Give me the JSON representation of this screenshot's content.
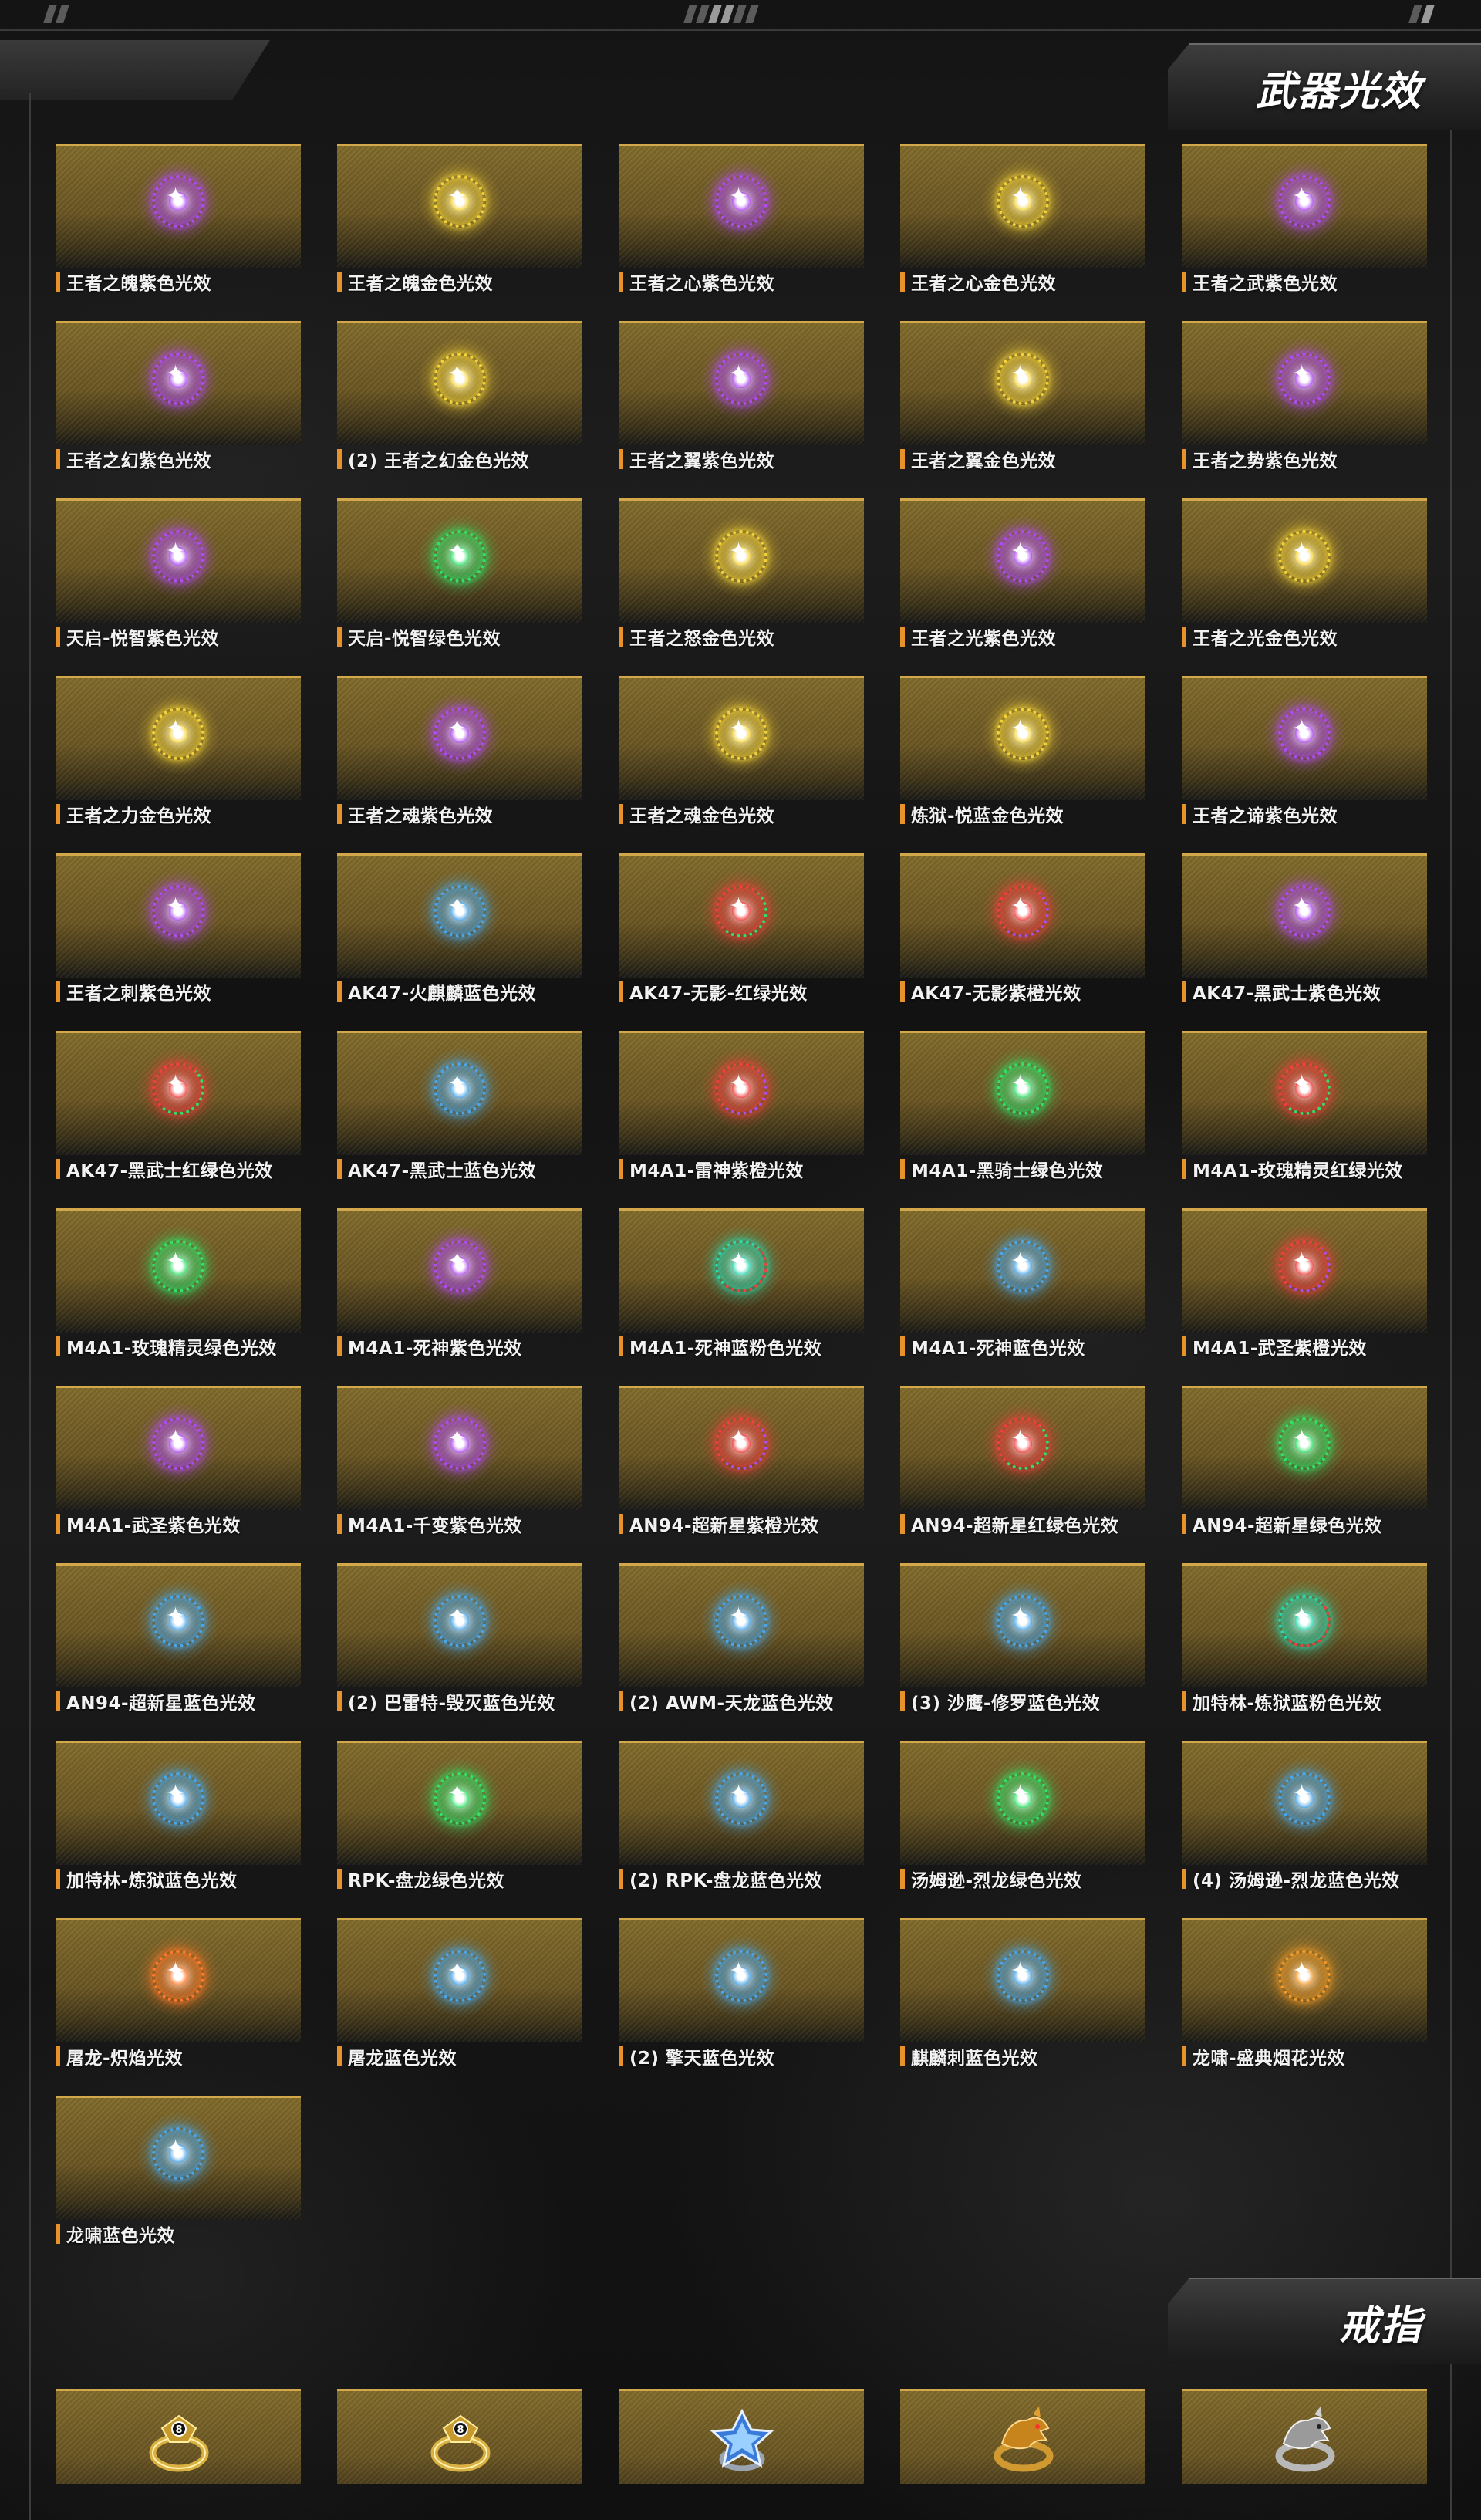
{
  "sections": {
    "effects": {
      "title": "武器光效"
    },
    "rings": {
      "title": "戒指"
    }
  },
  "colors": {
    "purple": "#b04cf0",
    "gold": "#f2d23a",
    "green": "#33e06a",
    "blue": "#4aa6e8",
    "red": "#f04040",
    "orange": "#ff7a2a",
    "amber": "#f09a2a",
    "teal": "#2ad9b0"
  },
  "effects": [
    {
      "label": "王者之魄紫色光效",
      "orb": "purple"
    },
    {
      "label": "王者之魄金色光效",
      "orb": "gold"
    },
    {
      "label": "王者之心紫色光效",
      "orb": "purple"
    },
    {
      "label": "王者之心金色光效",
      "orb": "gold"
    },
    {
      "label": "王者之武紫色光效",
      "orb": "purple"
    },
    {
      "label": "王者之幻紫色光效",
      "orb": "purple"
    },
    {
      "label": "(2) 王者之幻金色光效",
      "orb": "gold"
    },
    {
      "label": "王者之翼紫色光效",
      "orb": "purple"
    },
    {
      "label": "王者之翼金色光效",
      "orb": "gold"
    },
    {
      "label": "王者之势紫色光效",
      "orb": "purple"
    },
    {
      "label": "天启-悦智紫色光效",
      "orb": "purple"
    },
    {
      "label": "天启-悦智绿色光效",
      "orb": "green"
    },
    {
      "label": "王者之怒金色光效",
      "orb": "gold"
    },
    {
      "label": "王者之光紫色光效",
      "orb": "purple"
    },
    {
      "label": "王者之光金色光效",
      "orb": "gold"
    },
    {
      "label": "王者之力金色光效",
      "orb": "gold"
    },
    {
      "label": "王者之魂紫色光效",
      "orb": "purple"
    },
    {
      "label": "王者之魂金色光效",
      "orb": "gold"
    },
    {
      "label": "炼狱-悦蓝金色光效",
      "orb": "gold"
    },
    {
      "label": "王者之谛紫色光效",
      "orb": "purple"
    },
    {
      "label": "王者之刺紫色光效",
      "orb": "purple"
    },
    {
      "label": "AK47-火麒麟蓝色光效",
      "orb": "blue"
    },
    {
      "label": "AK47-无影-红绿光效",
      "orb": "red",
      "orb2": "green"
    },
    {
      "label": "AK47-无影紫橙光效",
      "orb": "red",
      "orb2": "purple"
    },
    {
      "label": "AK47-黑武士紫色光效",
      "orb": "purple"
    },
    {
      "label": "AK47-黑武士红绿色光效",
      "orb": "red",
      "orb2": "green"
    },
    {
      "label": "AK47-黑武士蓝色光效",
      "orb": "blue"
    },
    {
      "label": "M4A1-雷神紫橙光效",
      "orb": "red",
      "orb2": "purple"
    },
    {
      "label": "M4A1-黑骑士绿色光效",
      "orb": "green"
    },
    {
      "label": "M4A1-玫瑰精灵红绿光效",
      "orb": "red",
      "orb2": "green"
    },
    {
      "label": "M4A1-玫瑰精灵绿色光效",
      "orb": "green"
    },
    {
      "label": "M4A1-死神紫色光效",
      "orb": "purple"
    },
    {
      "label": "M4A1-死神蓝粉色光效",
      "orb": "teal",
      "orb2": "red"
    },
    {
      "label": "M4A1-死神蓝色光效",
      "orb": "blue"
    },
    {
      "label": "M4A1-武圣紫橙光效",
      "orb": "red",
      "orb2": "purple"
    },
    {
      "label": "M4A1-武圣紫色光效",
      "orb": "purple"
    },
    {
      "label": "M4A1-千变紫色光效",
      "orb": "purple"
    },
    {
      "label": "AN94-超新星紫橙光效",
      "orb": "red",
      "orb2": "purple"
    },
    {
      "label": "AN94-超新星红绿色光效",
      "orb": "red",
      "orb2": "green"
    },
    {
      "label": "AN94-超新星绿色光效",
      "orb": "green"
    },
    {
      "label": "AN94-超新星蓝色光效",
      "orb": "blue"
    },
    {
      "label": "(2) 巴雷特-毁灭蓝色光效",
      "orb": "blue"
    },
    {
      "label": "(2) AWM-天龙蓝色光效",
      "orb": "blue"
    },
    {
      "label": "(3) 沙鹰-修罗蓝色光效",
      "orb": "blue"
    },
    {
      "label": "加特林-炼狱蓝粉色光效",
      "orb": "teal",
      "orb2": "red"
    },
    {
      "label": "加特林-炼狱蓝色光效",
      "orb": "blue"
    },
    {
      "label": "RPK-盘龙绿色光效",
      "orb": "green"
    },
    {
      "label": "(2) RPK-盘龙蓝色光效",
      "orb": "blue"
    },
    {
      "label": "汤姆逊-烈龙绿色光效",
      "orb": "green"
    },
    {
      "label": "(4) 汤姆逊-烈龙蓝色光效",
      "orb": "blue"
    },
    {
      "label": "屠龙-炽焰光效",
      "orb": "orange"
    },
    {
      "label": "屠龙蓝色光效",
      "orb": "blue"
    },
    {
      "label": "(2) 擎天蓝色光效",
      "orb": "blue"
    },
    {
      "label": "麒麟刺蓝色光效",
      "orb": "blue"
    },
    {
      "label": "龙啸-盛典烟花光效",
      "orb": "amber"
    },
    {
      "label": "龙啸蓝色光效",
      "orb": "blue"
    }
  ],
  "rings": [
    {
      "icon": "gold-ring-icon",
      "kind": "gold"
    },
    {
      "icon": "gold-ring-icon",
      "kind": "gold"
    },
    {
      "icon": "gem-ring-icon",
      "kind": "gem"
    },
    {
      "icon": "gold-dragon-ring-icon",
      "kind": "gold-dragon"
    },
    {
      "icon": "silver-dragon-ring-icon",
      "kind": "silver-dragon"
    }
  ]
}
